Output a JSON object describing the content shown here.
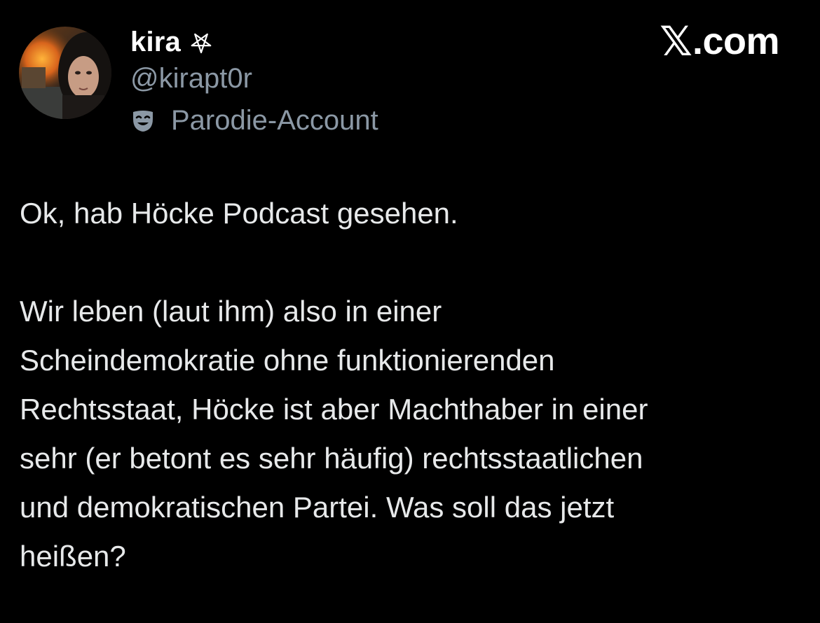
{
  "author": {
    "display_name": "kira",
    "badge_icon": "pentagram-icon",
    "handle": "@kirapt0r",
    "label_icon": "parody-mask-icon",
    "label": "Parodie-Account"
  },
  "brand": {
    "x": "𝕏",
    "domain": ".com"
  },
  "tweet": {
    "paragraph1": "Ok, hab Höcke Podcast gesehen.",
    "paragraph2_lines": [
      "Wir leben (laut ihm) also in einer",
      "Scheindemokratie ohne funktionierenden",
      "Rechtsstaat, Höcke ist aber Machthaber in einer",
      "sehr (er betont es sehr häufig) rechtsstaatlichen",
      "und demokratischen Partei. Was soll das jetzt",
      "heißen?"
    ]
  },
  "colors": {
    "background": "#000000",
    "primary_text": "#e7e9ea",
    "secondary_text": "#8b98a5"
  }
}
